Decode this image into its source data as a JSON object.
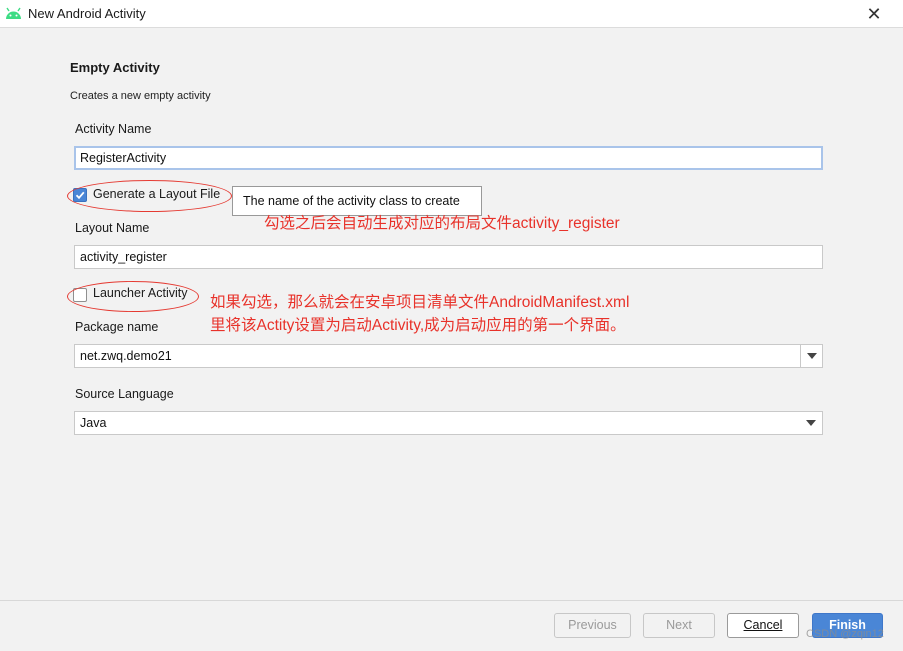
{
  "window": {
    "title": "New Android Activity",
    "close_glyph": "✕"
  },
  "header": {
    "title": "Empty Activity",
    "subtitle": "Creates a new empty activity"
  },
  "form": {
    "activity_name": {
      "label": "Activity Name",
      "value": "RegisterActivity"
    },
    "generate_layout": {
      "label": "Generate a Layout File",
      "checked": true
    },
    "tooltip": "The name of the activity class to create",
    "layout_name": {
      "label": "Layout Name",
      "value": "activity_register"
    },
    "launcher_activity": {
      "label": "Launcher Activity",
      "checked": false
    },
    "package_name": {
      "label": "Package name",
      "value": "net.zwq.demo21"
    },
    "source_language": {
      "label": "Source Language",
      "value": "Java"
    }
  },
  "annotations": {
    "layout_note": "勾选之后会自动生成对应的布局文件activity_register",
    "launcher_note_1": "如果勾选，那么就会在安卓项目清单文件AndroidManifest.xml",
    "launcher_note_2": "里将该Actity设置为启动Activity,成为启动应用的第一个界面。"
  },
  "buttons": {
    "previous": "Previous",
    "next": "Next",
    "cancel": "Cancel",
    "finish": "Finish"
  },
  "watermark": "CSDN @zqin12",
  "colors": {
    "accent": "#4a86d6",
    "annotation": "#e8322a",
    "android_green": "#3ddc84"
  }
}
